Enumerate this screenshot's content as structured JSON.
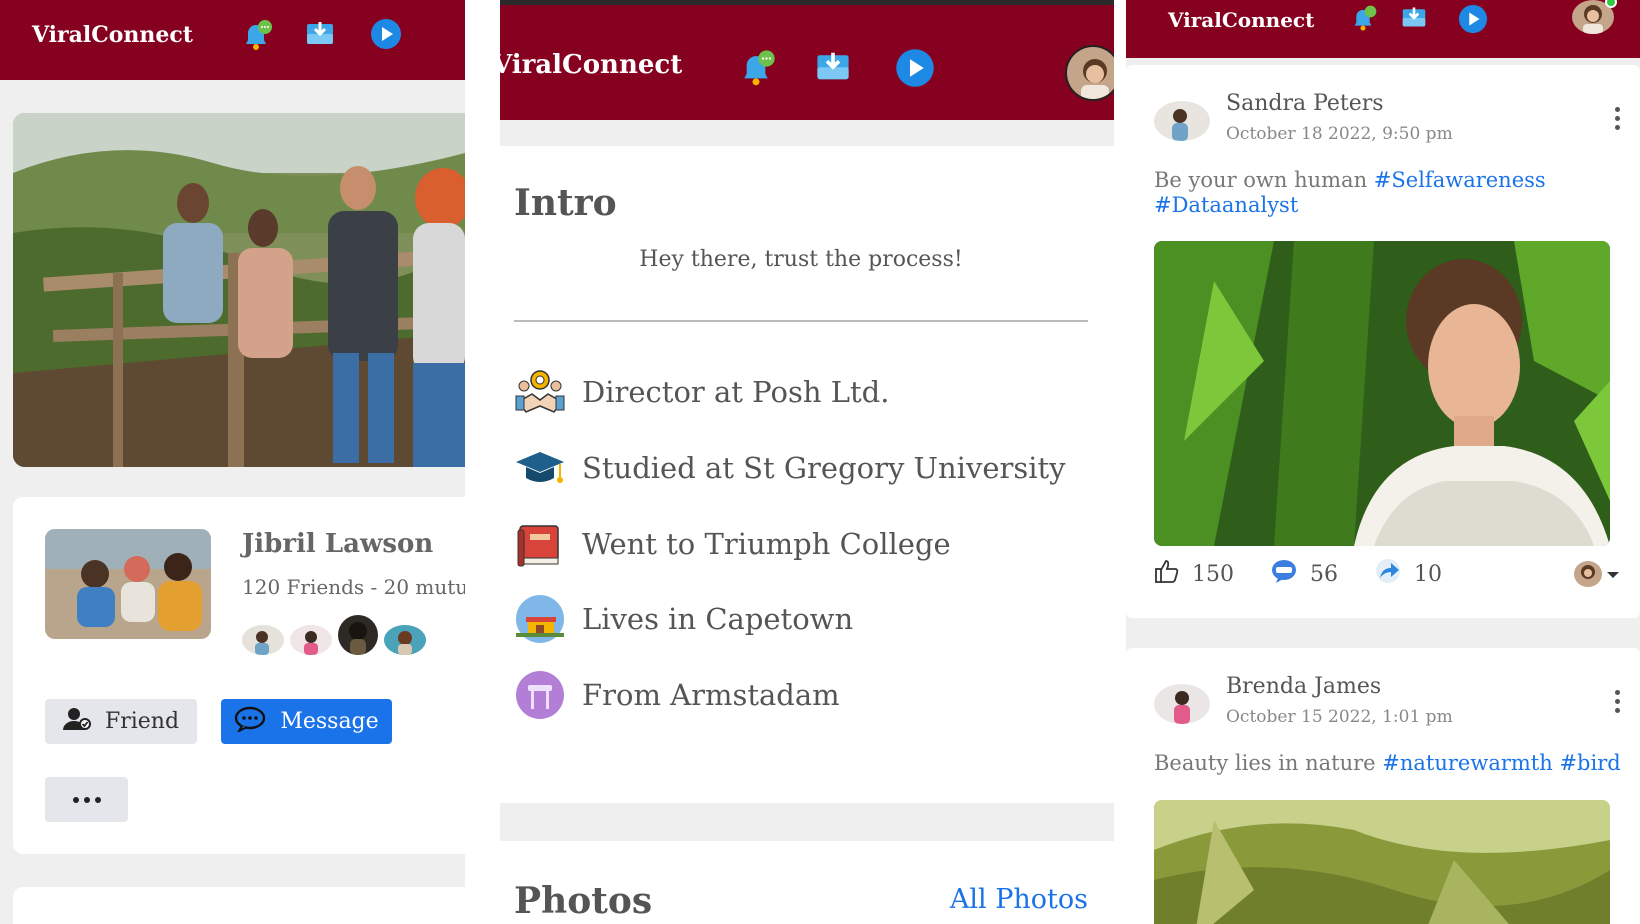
{
  "brand": "ViralConnect",
  "icons": {
    "bell": "notification-bell-icon",
    "inbox": "inbox-download-icon",
    "play": "play-icon"
  },
  "colors": {
    "header": "#860020",
    "accent": "#1a73e8",
    "online": "#2ecc40"
  },
  "profile": {
    "name": "Jibril Lawson",
    "friends_text": "120 Friends - 20 mutu",
    "friend_button": "Friend",
    "message_button": "Message"
  },
  "intro": {
    "title": "Intro",
    "bio": "Hey there, trust the process!",
    "items": [
      {
        "icon": "handshake-team-icon",
        "text": "Director at Posh Ltd."
      },
      {
        "icon": "graduation-cap-icon",
        "text": "Studied at St Gregory University"
      },
      {
        "icon": "book-icon",
        "text": "Went to Triumph College"
      },
      {
        "icon": "home-location-icon",
        "text": "Lives in Capetown"
      },
      {
        "icon": "origin-landmark-icon",
        "text": "From Armstadam"
      }
    ]
  },
  "photos": {
    "title": "Photos",
    "link": "All Photos"
  },
  "posts": [
    {
      "author": "Sandra Peters",
      "date": "October 18 2022, 9:50 pm",
      "text": "Be your own human",
      "hashtags": [
        "#Selfawareness",
        "#Dataanalyst"
      ],
      "likes": "150",
      "comments": "56",
      "shares": "10"
    },
    {
      "author": "Brenda James",
      "date": "October 15 2022, 1:01 pm",
      "text": "Beauty lies in nature",
      "hashtags": [
        "#naturewarmth",
        "#bird"
      ]
    }
  ]
}
